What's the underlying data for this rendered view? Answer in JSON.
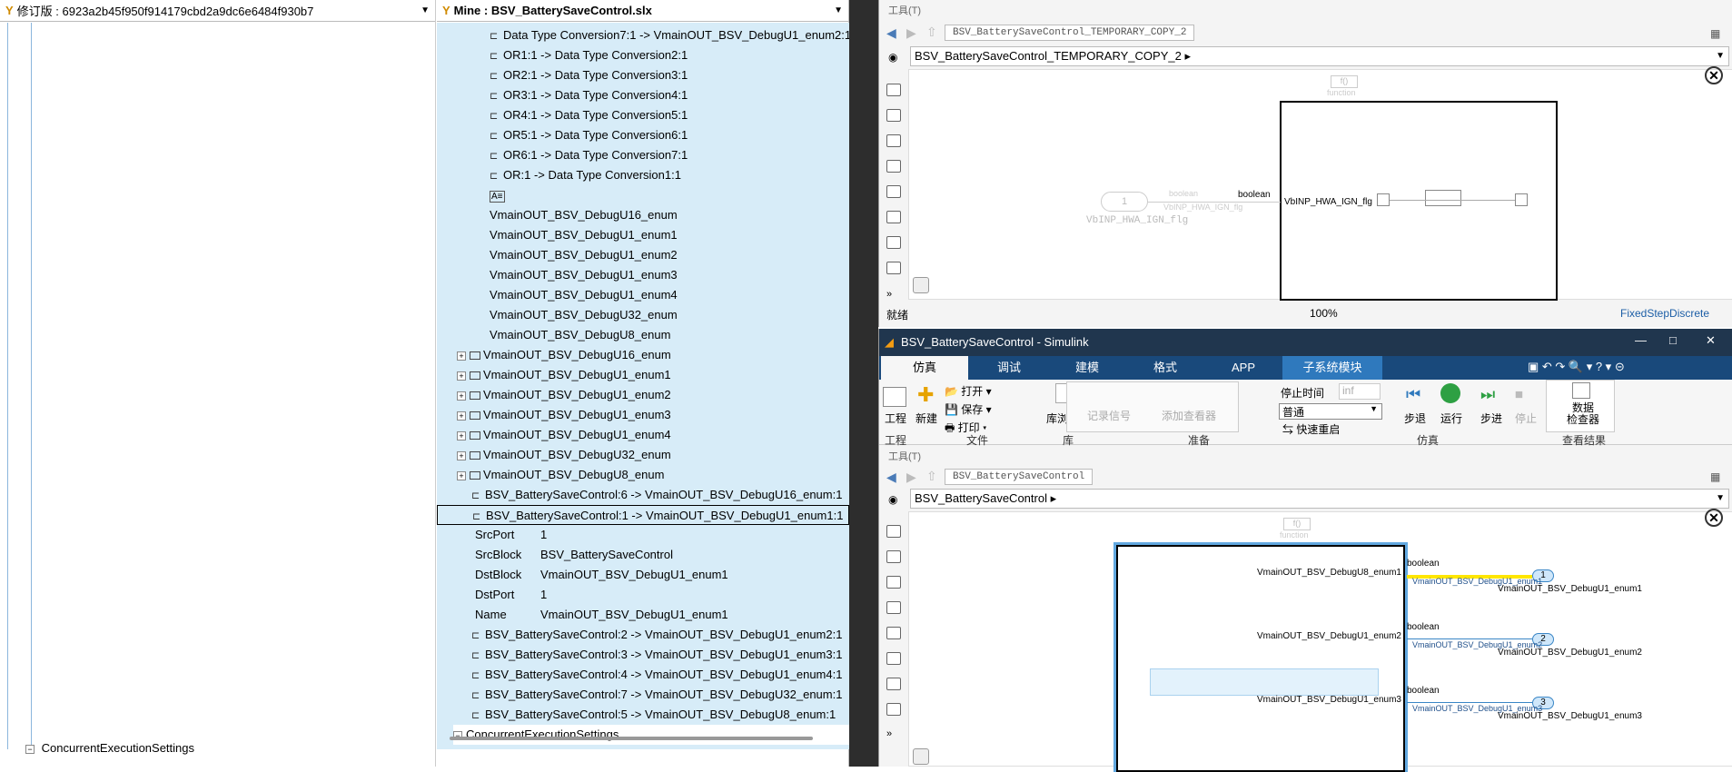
{
  "left_pane": {
    "revision_label": "修订版 : 6923a2b45f950f914179cbd2a9dc6e6484f930b7",
    "bottom_item": "ConcurrentExecutionSettings"
  },
  "mid_pane": {
    "header": "Mine : BSV_BatterySaveControl.slx",
    "rows_top": [
      "Data Type Conversion7:1 -> VmainOUT_BSV_DebugU1_enum2:1",
      "OR1:1 -> Data Type Conversion2:1",
      "OR2:1 -> Data Type Conversion3:1",
      "OR3:1 -> Data Type Conversion4:1",
      "OR4:1 -> Data Type Conversion5:1",
      "OR5:1 -> Data Type Conversion6:1",
      "OR6:1 -> Data Type Conversion7:1",
      "OR:1 -> Data Type Conversion1:1"
    ],
    "annotation_glyph": "A≡",
    "plain_items": [
      "VmainOUT_BSV_DebugU16_enum",
      "VmainOUT_BSV_DebugU1_enum1",
      "VmainOUT_BSV_DebugU1_enum2",
      "VmainOUT_BSV_DebugU1_enum3",
      "VmainOUT_BSV_DebugU1_enum4",
      "VmainOUT_BSV_DebugU32_enum",
      "VmainOUT_BSV_DebugU8_enum"
    ],
    "block_items": [
      "VmainOUT_BSV_DebugU16_enum",
      "VmainOUT_BSV_DebugU1_enum1",
      "VmainOUT_BSV_DebugU1_enum2",
      "VmainOUT_BSV_DebugU1_enum3",
      "VmainOUT_BSV_DebugU1_enum4",
      "VmainOUT_BSV_DebugU32_enum",
      "VmainOUT_BSV_DebugU8_enum"
    ],
    "line_6": "BSV_BatterySaveControl:6 -> VmainOUT_BSV_DebugU16_enum:1",
    "line_selected": "BSV_BatterySaveControl:1 -> VmainOUT_BSV_DebugU1_enum1:1",
    "props": [
      {
        "k": "SrcPort",
        "v": "1"
      },
      {
        "k": "SrcBlock",
        "v": "BSV_BatterySaveControl"
      },
      {
        "k": "DstBlock",
        "v": "VmainOUT_BSV_DebugU1_enum1"
      },
      {
        "k": "DstPort",
        "v": "1"
      },
      {
        "k": "Name",
        "v": "VmainOUT_BSV_DebugU1_enum1"
      }
    ],
    "rows_bottom": [
      "BSV_BatterySaveControl:2 -> VmainOUT_BSV_DebugU1_enum2:1",
      "BSV_BatterySaveControl:3 -> VmainOUT_BSV_DebugU1_enum3:1",
      "BSV_BatterySaveControl:4 -> VmainOUT_BSV_DebugU1_enum4:1",
      "BSV_BatterySaveControl:7 -> VmainOUT_BSV_DebugU32_enum:1",
      "BSV_BatterySaveControl:5 -> VmainOUT_BSV_DebugU8_enum:1"
    ],
    "bottom_item": "ConcurrentExecutionSettings"
  },
  "top_window": {
    "tools": "工具(T)",
    "tab": "BSV_BatterySaveControl_TEMPORARY_COPY_2",
    "address": "BSV_BatterySaveControl_TEMPORARY_COPY_2",
    "fn_label": "f()",
    "fn_sub": "function",
    "inport_num": "1",
    "inport_type": "boolean",
    "inport_signal": "VbINP_HWA_IGN_flg",
    "inport_name": "VbINP_HWA_IGN_flg",
    "boolean_label": "boolean",
    "block_port": "VbINP_HWA_IGN_flg",
    "status_ready": "就绪",
    "zoom": "100%",
    "solver": "FixedStepDiscrete"
  },
  "bottom_window": {
    "title": "BSV_BatterySaveControl - Simulink",
    "tabs": [
      "仿真",
      "调试",
      "建模",
      "格式",
      "APP",
      "子系统模块"
    ],
    "ribbon": {
      "project": "工程",
      "new": "新建",
      "open": "打开",
      "save": "保存",
      "print": "打印",
      "library": "库浏览器",
      "record": "记录信号",
      "add_viewer": "添加查看器",
      "stop_time_label": "停止时间",
      "stop_time_value": "inf",
      "mode": "普通",
      "fast_restart": "快速重启",
      "step_back": "步退",
      "run": "运行",
      "step_fwd": "步进",
      "stop": "停止",
      "inspector": "数据\n检查器",
      "groups": [
        "工程",
        "文件",
        "库",
        "准备",
        "仿真",
        "查看结果"
      ]
    },
    "tools": "工具(T)",
    "tab": "BSV_BatterySaveControl",
    "address": "BSV_BatterySaveControl",
    "fn_label": "f()",
    "fn_sub": "function",
    "outports": [
      {
        "inner": "VmainOUT_BSV_DebugU8_enum1",
        "type": "boolean",
        "num": "1",
        "sig": "VmainOUT_BSV_DebugU1_enum1",
        "name": "VmainOUT_BSV_DebugU1_enum1"
      },
      {
        "inner": "VmainOUT_BSV_DebugU1_enum2",
        "type": "boolean",
        "num": "2",
        "sig": "VmainOUT_BSV_DebugU1_enum2",
        "name": "VmainOUT_BSV_DebugU1_enum2"
      },
      {
        "inner": "VmainOUT_BSV_DebugU1_enum3",
        "type": "boolean",
        "num": "3",
        "sig": "VmainOUT_BSV_DebugU1_enum3",
        "name": "VmainOUT_BSV_DebugU1_enum3"
      }
    ]
  },
  "colors": {
    "tree_bg": "#d7ecf8",
    "ribbon_tab_bg": "#19497b",
    "title_bg": "#20364e",
    "highlight": "#ffe600"
  }
}
